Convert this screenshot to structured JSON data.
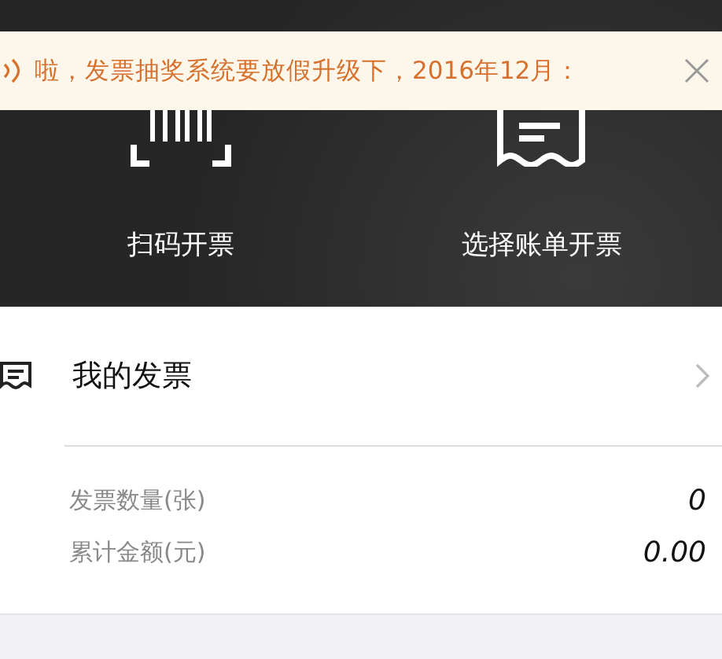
{
  "notice": {
    "text": "啦，发票抽奖系统要放假升级下，2016年12月："
  },
  "actions": [
    {
      "kind": "scan",
      "label": "扫码开票"
    },
    {
      "kind": "bill",
      "label": "选择账单开票"
    }
  ],
  "my_invoices": {
    "title": "我的发票"
  },
  "stats": [
    {
      "label": "发票数量(张)",
      "value": "0"
    },
    {
      "label": "累计金额(元)",
      "value": "0.00"
    }
  ]
}
